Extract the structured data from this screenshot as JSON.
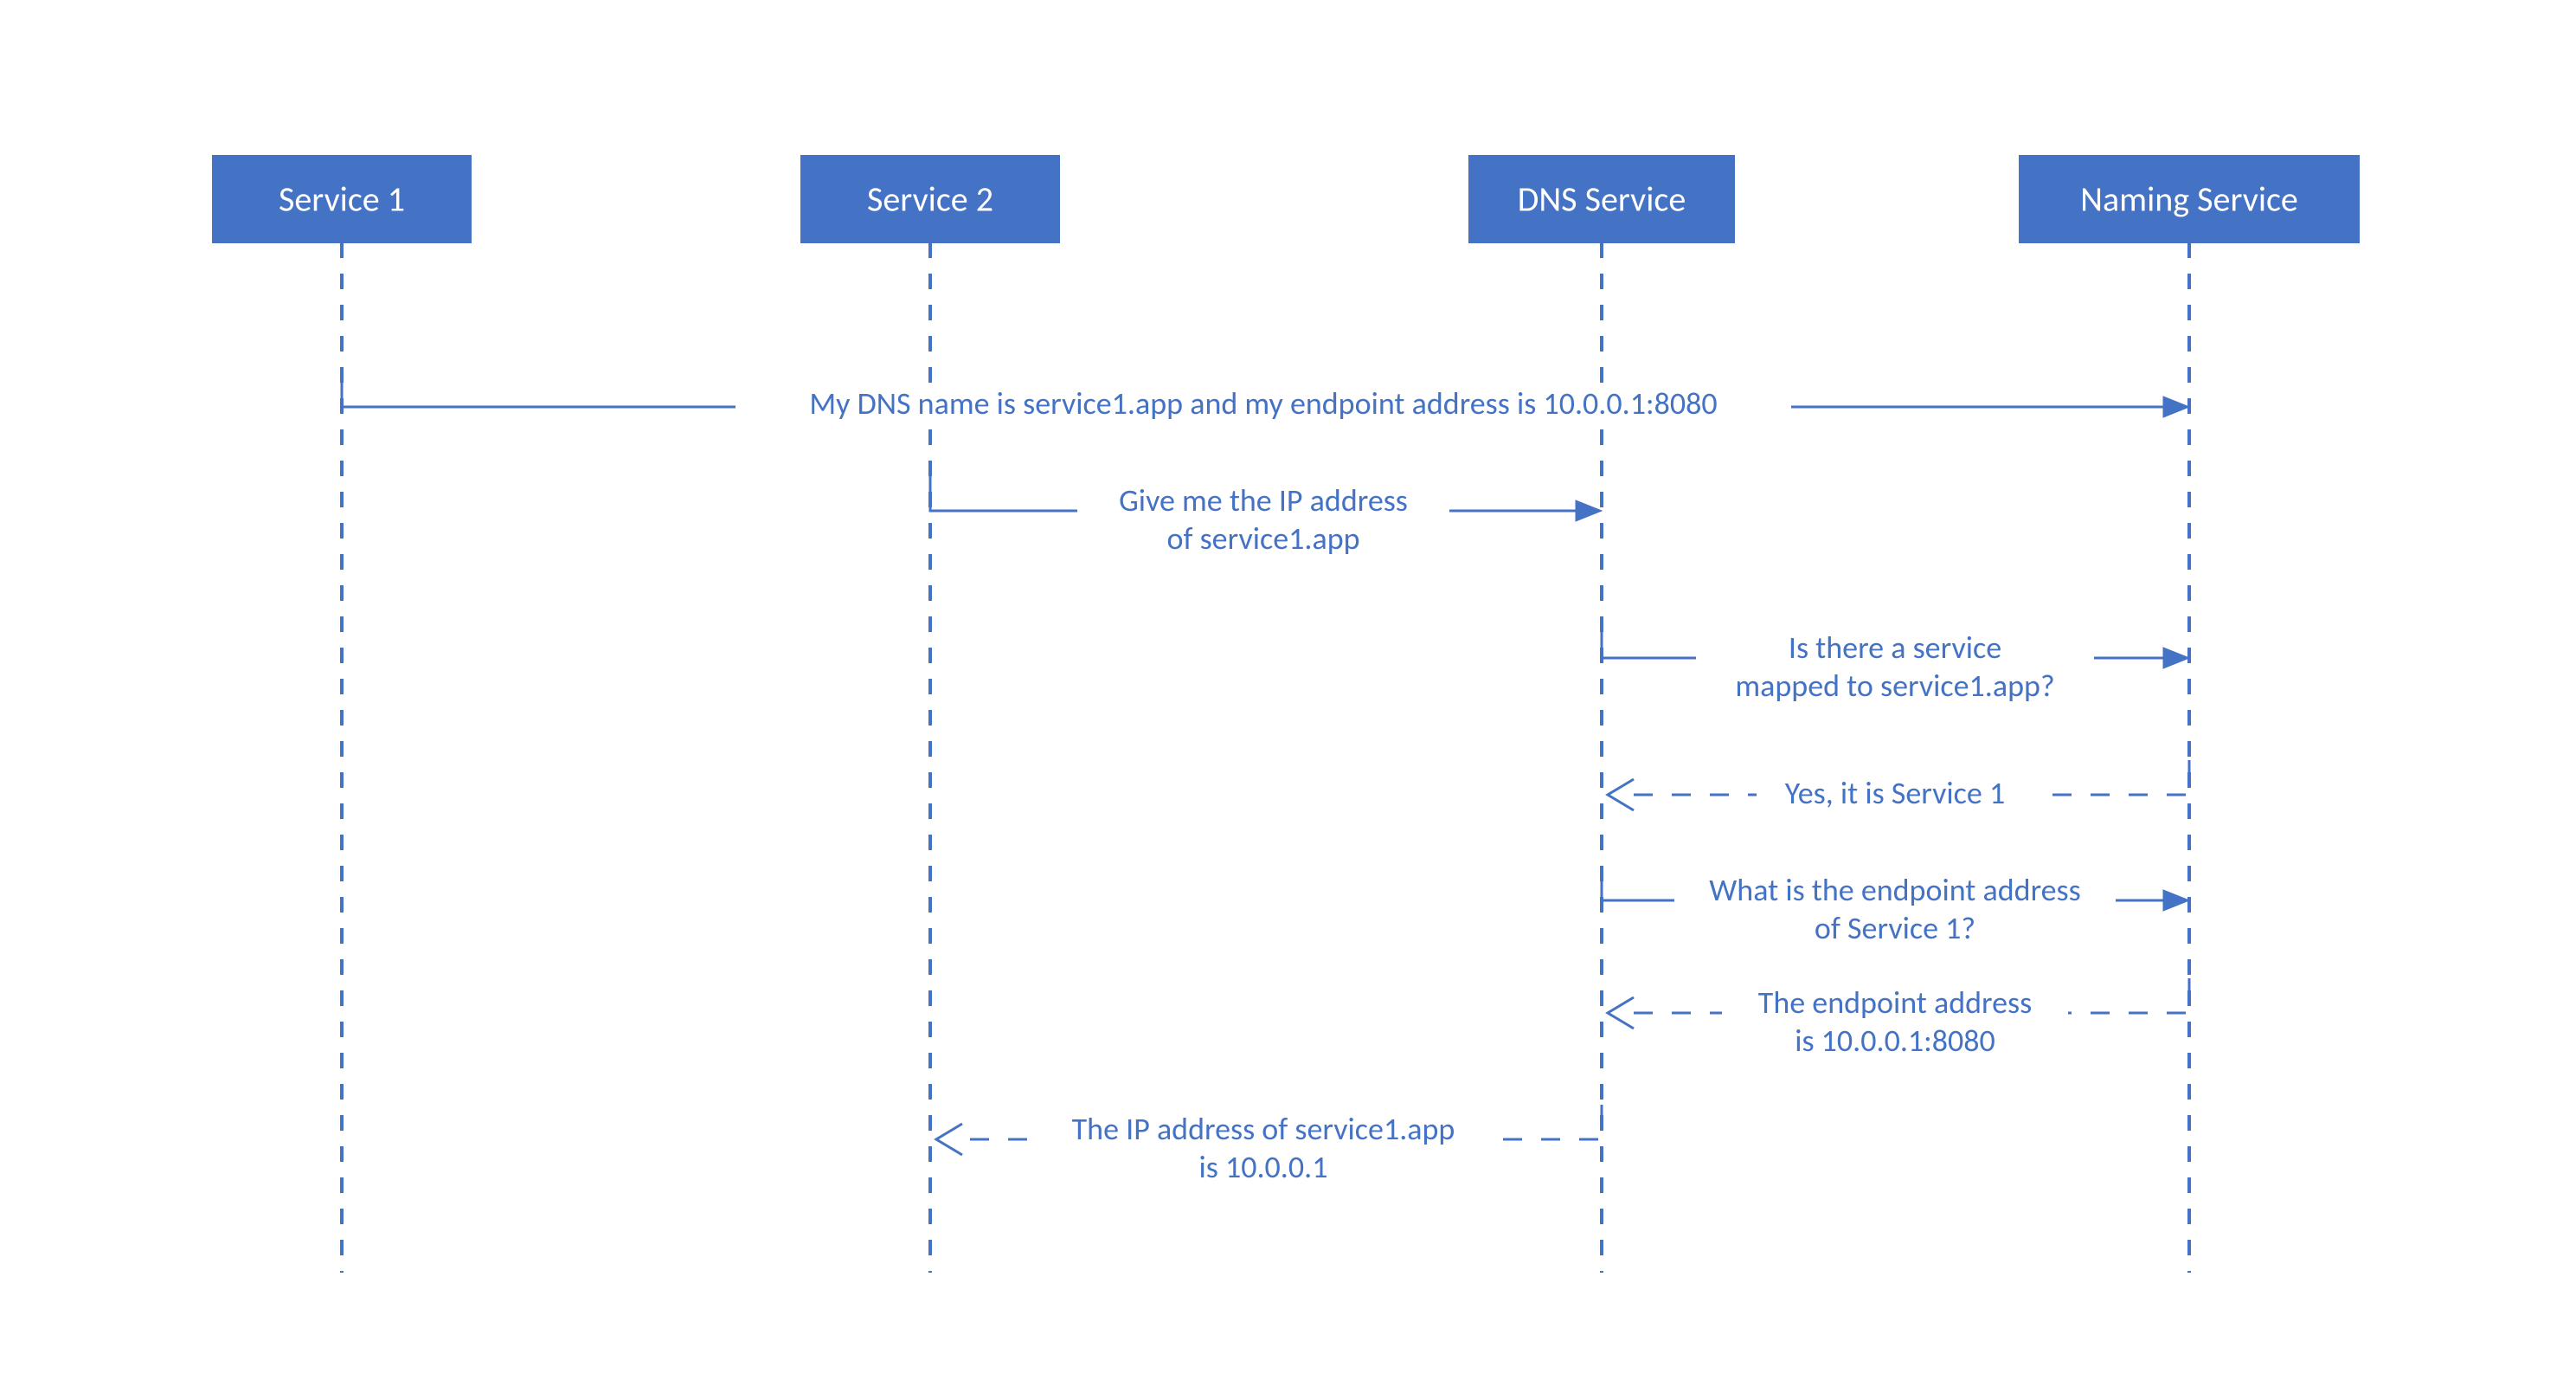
{
  "participants": {
    "p1": "Service 1",
    "p2": "Service 2",
    "p3": "DNS Service",
    "p4": "Naming Service"
  },
  "messages": {
    "m1": "My DNS name is service1.app and my endpoint address is 10.0.0.1:8080",
    "m2a": "Give me the IP address",
    "m2b": "of service1.app",
    "m3a": "Is there a service",
    "m3b": "mapped to service1.app?",
    "m4": "Yes, it is Service 1",
    "m5a": "What is the endpoint address",
    "m5b": "of Service 1?",
    "m6a": "The endpoint address",
    "m6b": "is 10.0.0.1:8080",
    "m7a": "The IP address of service1.app",
    "m7b": "is 10.0.0.1"
  },
  "chart_data": {
    "type": "sequence-diagram",
    "participants": [
      "Service 1",
      "Service 2",
      "DNS Service",
      "Naming Service"
    ],
    "interactions": [
      {
        "from": "Service 1",
        "to": "Naming Service",
        "kind": "request",
        "text": "My DNS name is service1.app and my endpoint address is 10.0.0.1:8080"
      },
      {
        "from": "Service 2",
        "to": "DNS Service",
        "kind": "request",
        "text": "Give me the IP address of service1.app"
      },
      {
        "from": "DNS Service",
        "to": "Naming Service",
        "kind": "request",
        "text": "Is there a service mapped to service1.app?"
      },
      {
        "from": "Naming Service",
        "to": "DNS Service",
        "kind": "response",
        "text": "Yes, it is Service 1"
      },
      {
        "from": "DNS Service",
        "to": "Naming Service",
        "kind": "request",
        "text": "What is the endpoint address of Service 1?"
      },
      {
        "from": "Naming Service",
        "to": "DNS Service",
        "kind": "response",
        "text": "The endpoint address is 10.0.0.1:8080"
      },
      {
        "from": "DNS Service",
        "to": "Service 2",
        "kind": "response",
        "text": "The IP address of service1.app is 10.0.0.1"
      }
    ]
  }
}
